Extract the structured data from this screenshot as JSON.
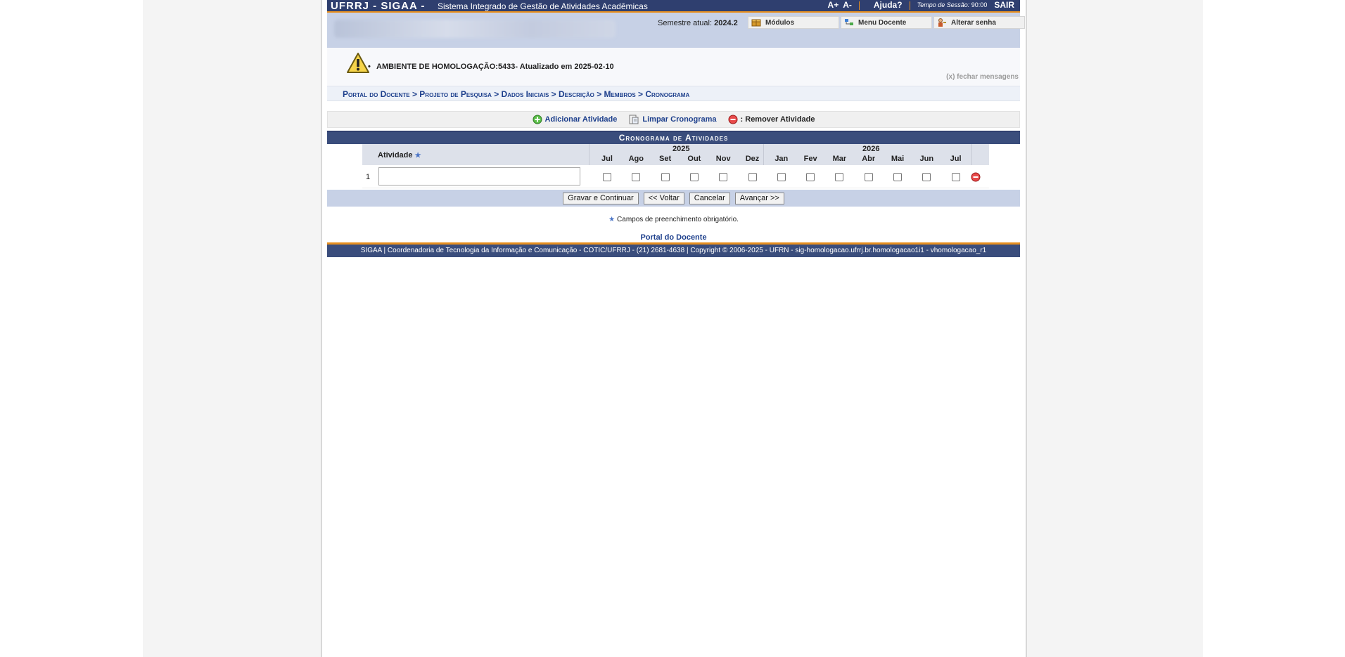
{
  "header": {
    "brand": "UFRRJ - SIGAA -",
    "system_name": "Sistema Integrado de Gestão de Atividades Acadêmicas",
    "font_increase": "A+",
    "font_decrease": "A-",
    "help": "Ajuda?",
    "session_label": "Tempo de Sessão:",
    "session_time": "90:00",
    "logout": "SAIR"
  },
  "subheader": {
    "semester_label": "Semestre atual:",
    "semester_value": "2024.2",
    "modules": "Módulos",
    "teacher_menu": "Menu Docente",
    "change_password": "Alterar senha"
  },
  "messages": {
    "text": "AMBIENTE DE HOMOLOGAÇÃO:5433- Atualizado em 2025-02-10",
    "close": "(x) fechar mensagens"
  },
  "breadcrumb": [
    "Portal do Docente",
    "Projeto de Pesquisa",
    "Dados Iniciais",
    "Descrição",
    "Membros",
    "Cronograma"
  ],
  "breadcrumb_text": "Portal do Docente > Projeto de Pesquisa > Dados Iniciais > Descrição > Membros > Cronograma",
  "actions": {
    "add": "Adicionar Atividade",
    "clear": "Limpar Cronograma",
    "remove": ": Remover Atividade"
  },
  "table": {
    "caption": "Cronograma de Atividades",
    "activity_header": "Atividade",
    "years": [
      "2025",
      "2026"
    ],
    "months": [
      "Jul",
      "Ago",
      "Set",
      "Out",
      "Nov",
      "Dez",
      "Jan",
      "Fev",
      "Mar",
      "Abr",
      "Mai",
      "Jun",
      "Jul"
    ],
    "rows": [
      {
        "number": "1",
        "activity": "",
        "checked": [
          false,
          false,
          false,
          false,
          false,
          false,
          false,
          false,
          false,
          false,
          false,
          false,
          false
        ]
      }
    ]
  },
  "buttons": {
    "save": "Gravar e Continuar",
    "back": "<< Voltar",
    "cancel": "Cancelar",
    "next": "Avançar >>"
  },
  "required_note": "Campos de preenchimento obrigatório.",
  "portal_link": "Portal do Docente",
  "footer": "SIGAA | Coordenadoria de Tecnologia da Informação e Comunicação - COTIC/UFRRJ - (21) 2681-4638 | Copyright © 2006-2025 - UFRN - sig-homologacao.ufrrj.br.homologacao1i1 - vhomologacao_r1",
  "colors": {
    "header_bg": "#2f3f6f",
    "accent": "#e78f1f",
    "link": "#1d3f8c",
    "subheader_bg": "#c7d1e6"
  }
}
